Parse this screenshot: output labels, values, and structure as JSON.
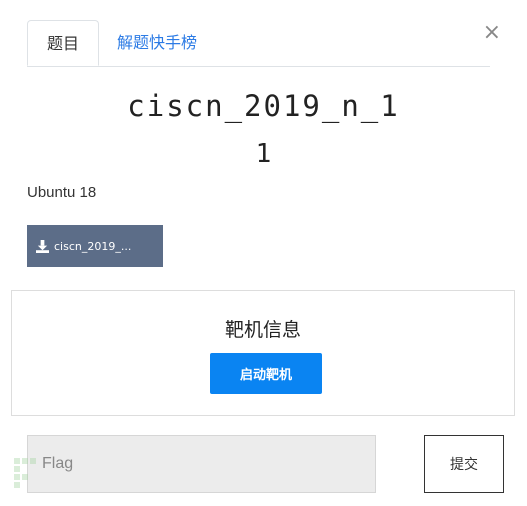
{
  "tabs": [
    {
      "label": "题目",
      "active": true
    },
    {
      "label": "解题快手榜",
      "active": false
    }
  ],
  "close_label": "×",
  "challenge": {
    "name": "ciscn_2019_n_1",
    "points": "1",
    "description": "Ubuntu 18",
    "file_label": "ciscn_2019_..."
  },
  "target": {
    "title": "靶机信息",
    "start_label": "启动靶机"
  },
  "flag": {
    "placeholder": "Flag",
    "value": "",
    "submit_label": "提交"
  },
  "watermark": {
    "text": "FREEBUF"
  },
  "colors": {
    "accent": "#0a84f2",
    "download_button": "#5c6d88",
    "tab_link": "#2c7be5"
  },
  "icons": {
    "download": "download-icon",
    "close": "close-icon"
  }
}
